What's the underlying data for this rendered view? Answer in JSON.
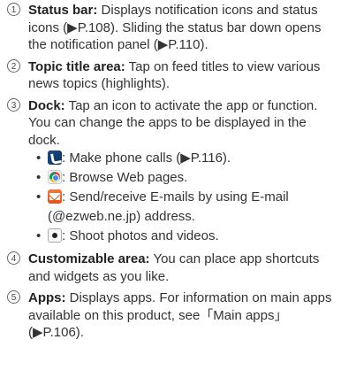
{
  "items": [
    {
      "number": "1",
      "term": "Status bar:",
      "text": " Displays notification icons and status icons (▶P.108). Sliding the status bar down opens the notification panel (▶P.110)."
    },
    {
      "number": "2",
      "term": "Topic title area:",
      "text": " Tap on feed titles to view various news topics (highlights)."
    },
    {
      "number": "3",
      "term": "Dock:",
      "text": " Tap an icon to activate the app or function. You can change the apps to be displayed in the dock.",
      "bullets": [
        {
          "icon": "phone-icon",
          "text": ": Make phone calls (▶P.116)."
        },
        {
          "icon": "chrome-browser-icon",
          "text": ": Browse Web pages."
        },
        {
          "icon": "email-icon",
          "text": ": Send/receive E-mails by using E-mail (@ezweb.ne.jp) address."
        },
        {
          "icon": "camera-icon",
          "text": ": Shoot photos and videos."
        }
      ]
    },
    {
      "number": "4",
      "term": "Customizable area:",
      "text": " You can place app shortcuts and widgets as you like."
    },
    {
      "number": "5",
      "term": "Apps:",
      "text": " Displays apps. For information on main apps available on this product, see「Main apps」(▶P.106)."
    }
  ],
  "bullet_char": "•"
}
